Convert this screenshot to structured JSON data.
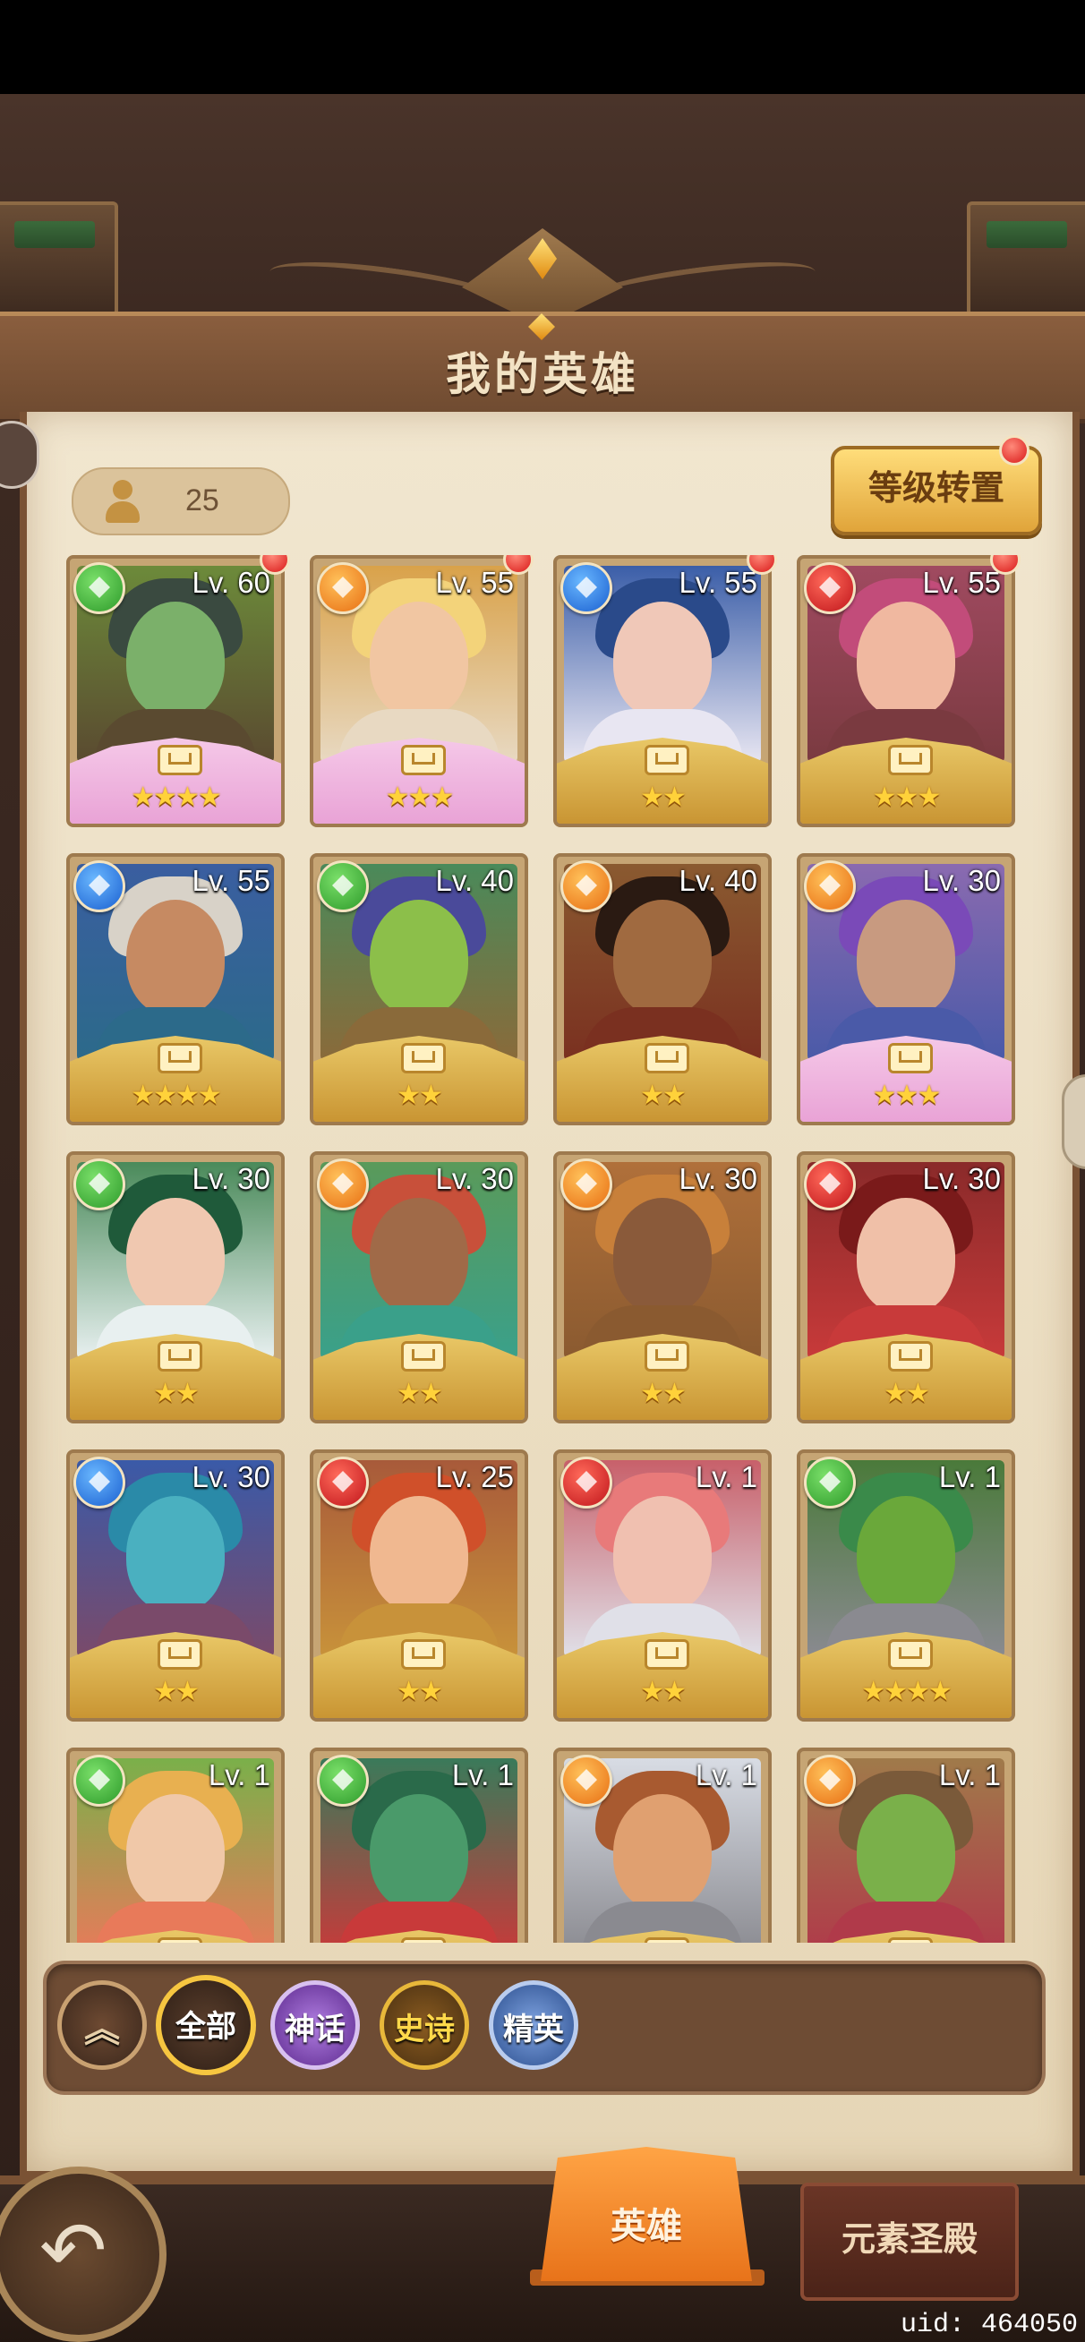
{
  "header": {
    "title": "我的英雄"
  },
  "hero_count": "25",
  "level_transfer_button": "等级转置",
  "heroes": [
    {
      "level": "Lv. 60",
      "element": "green",
      "stars": "★★★★",
      "rarity": "myth",
      "dot": true,
      "palette": [
        "#6c8a3a",
        "#3a4a40",
        "#7bb06a",
        "#5a4a30"
      ]
    },
    {
      "level": "Lv. 55",
      "element": "orange",
      "stars": "★★★",
      "rarity": "myth",
      "dot": true,
      "palette": [
        "#d9a24a",
        "#f3d37a",
        "#f1c6a2",
        "#e8d9c2"
      ]
    },
    {
      "level": "Lv. 55",
      "element": "blue",
      "stars": "★★",
      "rarity": "epic",
      "dot": true,
      "palette": [
        "#3b5ea8",
        "#2a4a8a",
        "#f0c8b8",
        "#e8e6f2"
      ]
    },
    {
      "level": "Lv. 55",
      "element": "red",
      "stars": "★★★",
      "rarity": "epic",
      "dot": true,
      "palette": [
        "#a04a60",
        "#c24c7a",
        "#f0b8a0",
        "#7a3a40"
      ]
    },
    {
      "level": "Lv. 55",
      "element": "blue",
      "stars": "★★★★",
      "rarity": "epic",
      "dot": false,
      "palette": [
        "#3a5ea0",
        "#d8d2c8",
        "#c68a62",
        "#2c6a8a"
      ]
    },
    {
      "level": "Lv. 40",
      "element": "green",
      "stars": "★★",
      "rarity": "epic",
      "dot": false,
      "palette": [
        "#4a8a5a",
        "#4a4a9a",
        "#8cbf4a",
        "#8a6a3a"
      ]
    },
    {
      "level": "Lv. 40",
      "element": "orange",
      "stars": "★★",
      "rarity": "epic",
      "dot": false,
      "palette": [
        "#8a5a30",
        "#2a1a12",
        "#a06a40",
        "#7a3020"
      ]
    },
    {
      "level": "Lv. 30",
      "element": "orange",
      "stars": "★★★",
      "rarity": "myth",
      "dot": false,
      "palette": [
        "#8a6ab0",
        "#7a4ab8",
        "#c89a80",
        "#4a5aa8"
      ]
    },
    {
      "level": "Lv. 30",
      "element": "green",
      "stars": "★★",
      "rarity": "epic",
      "dot": false,
      "palette": [
        "#4a8a5a",
        "#1f5a3a",
        "#f0c8b0",
        "#e8f0f0"
      ]
    },
    {
      "level": "Lv. 30",
      "element": "orange",
      "stars": "★★",
      "rarity": "epic",
      "dot": false,
      "palette": [
        "#5a9a5a",
        "#c8503a",
        "#a06a48",
        "#3aa08a"
      ]
    },
    {
      "level": "Lv. 30",
      "element": "orange",
      "stars": "★★",
      "rarity": "epic",
      "dot": false,
      "palette": [
        "#b0703a",
        "#c8803a",
        "#8a5a3a",
        "#8a5a30"
      ]
    },
    {
      "level": "Lv. 30",
      "element": "red",
      "stars": "★★",
      "rarity": "epic",
      "dot": false,
      "palette": [
        "#8a2a2a",
        "#7a1a1a",
        "#f0c0a8",
        "#c83a3a"
      ]
    },
    {
      "level": "Lv. 30",
      "element": "blue",
      "stars": "★★",
      "rarity": "epic",
      "dot": false,
      "palette": [
        "#3a5aa8",
        "#2a8aa8",
        "#4ab0c0",
        "#7a4a6a"
      ]
    },
    {
      "level": "Lv. 25",
      "element": "red",
      "stars": "★★",
      "rarity": "epic",
      "dot": false,
      "palette": [
        "#a85a3a",
        "#d0502a",
        "#f0b890",
        "#c8923a"
      ]
    },
    {
      "level": "Lv. 1",
      "element": "red",
      "stars": "★★",
      "rarity": "epic",
      "dot": false,
      "palette": [
        "#c8606a",
        "#e87a7a",
        "#f0c0b0",
        "#e0e0e8"
      ]
    },
    {
      "level": "Lv. 1",
      "element": "green",
      "stars": "★★★★",
      "rarity": "epic",
      "dot": false,
      "palette": [
        "#4a7a3a",
        "#3a8a4a",
        "#6aa83a",
        "#8a8a90"
      ]
    },
    {
      "level": "Lv. 1",
      "element": "green",
      "stars": "",
      "rarity": "epic",
      "dot": false,
      "palette": [
        "#7ab04a",
        "#e8b050",
        "#f0c8a8",
        "#e87a5a"
      ]
    },
    {
      "level": "Lv. 1",
      "element": "green",
      "stars": "",
      "rarity": "epic",
      "dot": false,
      "palette": [
        "#3a7a5a",
        "#2a6a4a",
        "#4a9a6a",
        "#c83a3a"
      ]
    },
    {
      "level": "Lv. 1",
      "element": "orange",
      "stars": "",
      "rarity": "epic",
      "dot": false,
      "palette": [
        "#d8dce4",
        "#a85a30",
        "#e0a070",
        "#8a8a90"
      ]
    },
    {
      "level": "Lv. 1",
      "element": "orange",
      "stars": "",
      "rarity": "epic",
      "dot": false,
      "palette": [
        "#a07a4a",
        "#7a5a3a",
        "#7ab04a",
        "#b03a4a"
      ]
    }
  ],
  "filters": {
    "collapse_label": "︽",
    "all": "全部",
    "myth": "神话",
    "epic": "史诗",
    "elite": "精英"
  },
  "bottom_nav": {
    "back_label": "↶",
    "heroes_tab": "英雄",
    "element_temple_tab": "元素圣殿"
  },
  "uid_text": "uid: 464050"
}
